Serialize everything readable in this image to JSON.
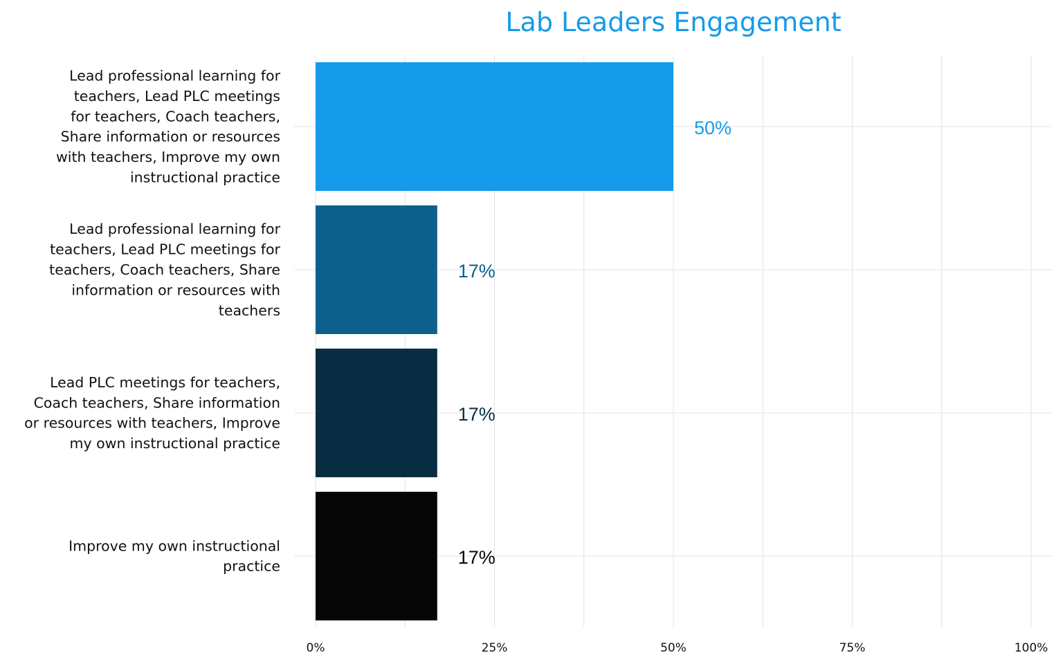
{
  "chart_data": {
    "type": "bar",
    "orientation": "horizontal",
    "title": "Lab Leaders Engagement",
    "xlabel": "",
    "ylabel": "",
    "xlim": [
      0,
      100
    ],
    "grid": true,
    "legend": "none",
    "x_ticks": [
      "0%",
      "25%",
      "50%",
      "75%",
      "100%"
    ],
    "x_tick_values": [
      0,
      25,
      50,
      75,
      100
    ],
    "categories": [
      [
        "Lead professional learning for",
        "teachers, Lead PLC meetings",
        "for teachers, Coach teachers,",
        "Share information or resources",
        "with teachers, Improve my own",
        "instructional practice"
      ],
      [
        "Lead professional learning for",
        "teachers, Lead PLC meetings for",
        "teachers, Coach teachers, Share",
        "information or resources with",
        "teachers"
      ],
      [
        "Lead PLC meetings for teachers,",
        "Coach teachers, Share information",
        "or resources with teachers, Improve",
        "my own instructional practice"
      ],
      [
        "Improve my own instructional",
        "practice"
      ]
    ],
    "values": [
      50,
      17,
      17,
      17
    ],
    "data_labels": [
      "50%",
      "17%",
      "17%",
      "17%"
    ],
    "colors": [
      "#159be9",
      "#0d5f8c",
      "#082d42",
      "#060606"
    ],
    "title_color": "#159be9"
  }
}
